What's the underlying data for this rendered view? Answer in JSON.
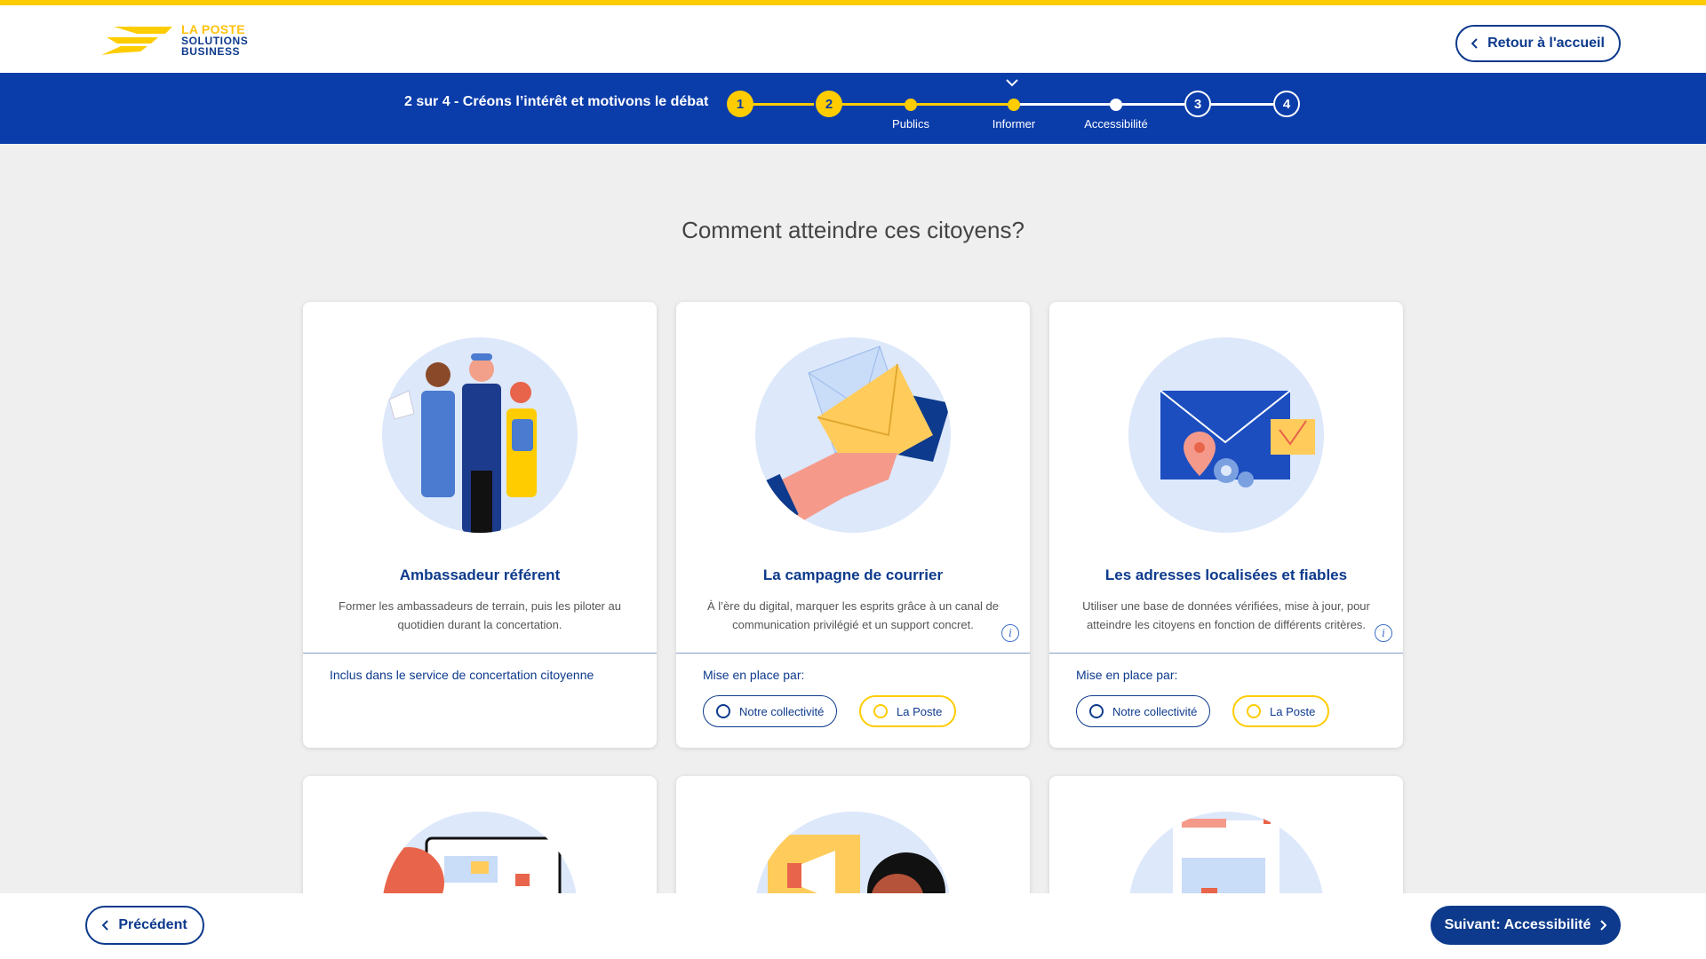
{
  "brand": {
    "line1": "LA POSTE",
    "line2": "SOLUTIONS",
    "line3": "BUSINESS"
  },
  "header": {
    "home_button": "Retour à l'accueil"
  },
  "stepper": {
    "label": "2 sur 4 - Créons l’intérêt et motivons le débat",
    "steps": [
      {
        "number": "1"
      },
      {
        "number": "2"
      },
      {
        "sub_label": "Publics"
      },
      {
        "sub_label": "Informer"
      },
      {
        "sub_label": "Accessibilité"
      },
      {
        "number": "3"
      },
      {
        "number": "4"
      }
    ]
  },
  "main": {
    "question": "Comment atteindre ces citoyens?",
    "cards": [
      {
        "title": "Ambassadeur référent",
        "description": "Former les ambassadeurs de terrain, puis les piloter au quotidien durant la concertation.",
        "footer_note": "Inclus dans le service de concertation citoyenne"
      },
      {
        "title": "La campagne de courrier",
        "description": "À l’ère du digital, marquer les esprits grâce à un canal de communication privilégié et un support concret.",
        "footer_label": "Mise en place par:",
        "option_a": "Notre collectivité",
        "option_b": "La Poste",
        "info": "i"
      },
      {
        "title": "Les adresses localisées et fiables",
        "description": "Utiliser une base de données vérifiées, mise à jour, pour atteindre les citoyens en fonction de différents critères.",
        "footer_label": "Mise en place par:",
        "option_a": "Notre collectivité",
        "option_b": "La Poste",
        "info": "i"
      }
    ]
  },
  "footer": {
    "prev_button": "Précédent",
    "next_button": "Suivant: Accessibilité"
  },
  "colors": {
    "brand_blue": "#0a3caa",
    "dark_blue": "#0d3a8c",
    "yellow": "#ffcc00"
  }
}
